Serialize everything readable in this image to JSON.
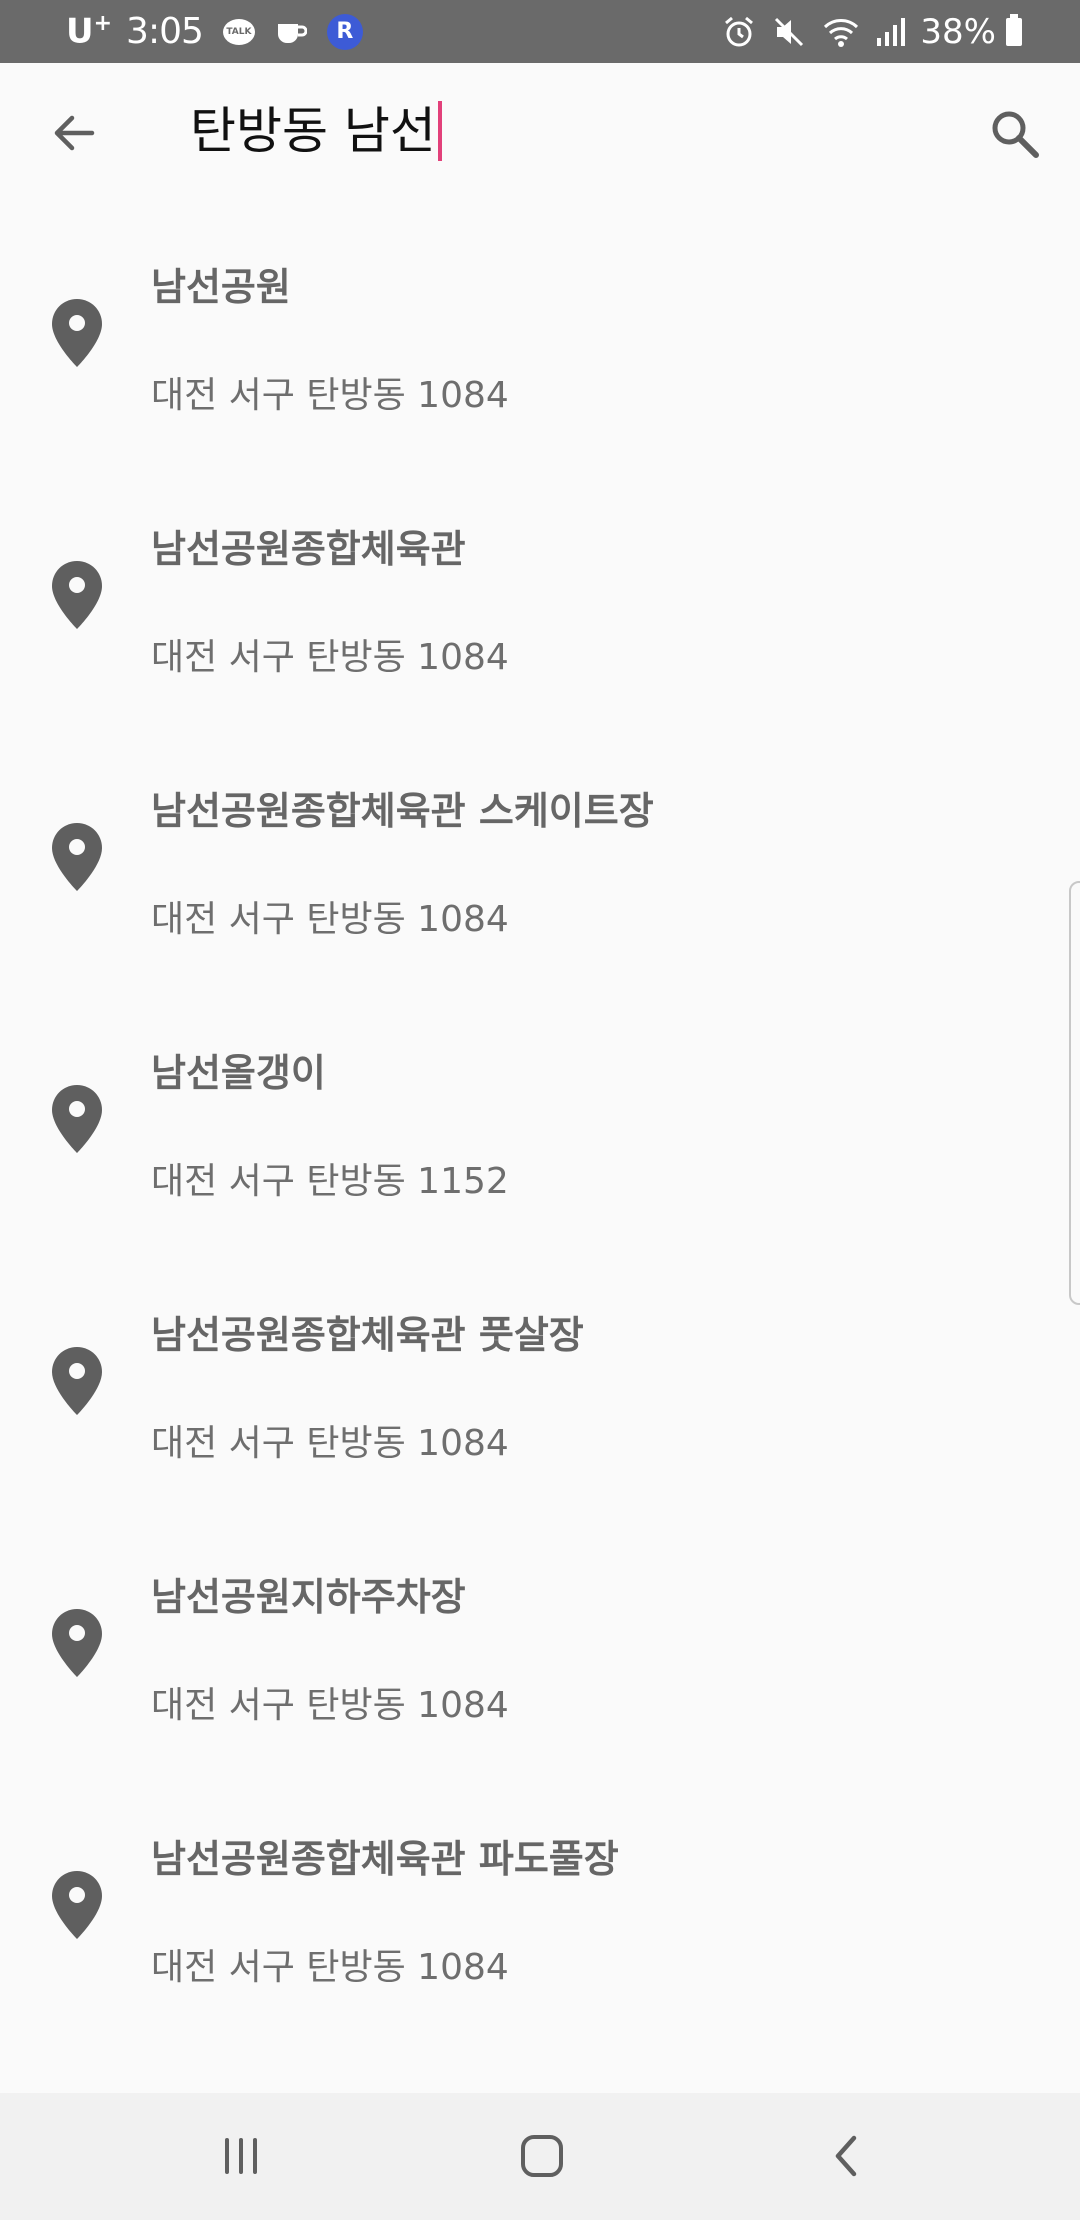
{
  "status_bar": {
    "carrier": "U",
    "carrier_sup": "+",
    "time": "3:05",
    "talk_label": "TALK",
    "r_app": "R",
    "battery": "38%"
  },
  "search": {
    "query": "탄방동 남선"
  },
  "results": [
    {
      "name": "남선공원",
      "address": "대전 서구 탄방동 1084"
    },
    {
      "name": "남선공원종합체육관",
      "address": "대전 서구 탄방동 1084"
    },
    {
      "name": "남선공원종합체육관 스케이트장",
      "address": "대전 서구 탄방동 1084"
    },
    {
      "name": "남선올갱이",
      "address": "대전 서구 탄방동 1152"
    },
    {
      "name": "남선공원종합체육관 풋살장",
      "address": "대전 서구 탄방동 1084"
    },
    {
      "name": "남선공원지하주차장",
      "address": "대전 서구 탄방동 1084"
    },
    {
      "name": "남선공원종합체육관 파도풀장",
      "address": "대전 서구 탄방동 1084"
    }
  ],
  "colors": {
    "status_bar_bg": "#6a6a6a",
    "cursor": "#e2407a",
    "pin": "#5f5f5f",
    "text": "#666666"
  },
  "icons": {
    "back": "arrow-left-icon",
    "search": "search-icon",
    "pin": "location-pin-icon",
    "nav_recent": "recent-apps-icon",
    "nav_home": "home-icon",
    "nav_back": "back-chevron-icon"
  }
}
